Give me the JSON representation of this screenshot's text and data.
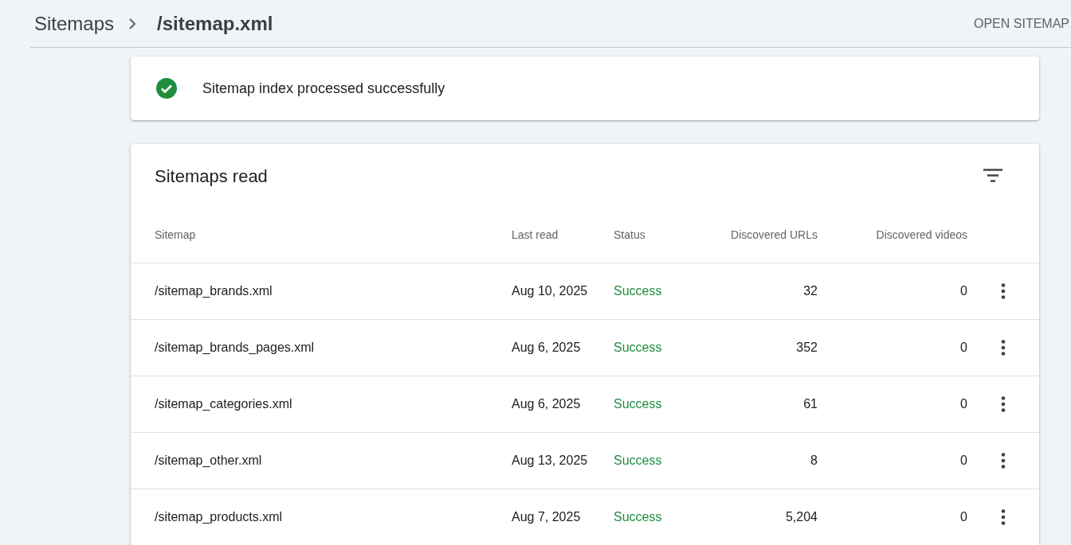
{
  "breadcrumb": [
    {
      "label": "Sitemaps"
    },
    {
      "label": "/sitemap.xml"
    }
  ],
  "header_action": "OPEN SITEMAP",
  "banner": {
    "message": "Sitemap index processed successfully"
  },
  "table": {
    "title": "Sitemaps read",
    "columns": [
      "Sitemap",
      "Last read",
      "Status",
      "Discovered URLs",
      "Discovered videos"
    ],
    "rows": [
      {
        "sitemap": "/sitemap_brands.xml",
        "last_read": "Aug 10, 2025",
        "status": "Success",
        "urls": "32",
        "videos": "0"
      },
      {
        "sitemap": "/sitemap_brands_pages.xml",
        "last_read": "Aug 6, 2025",
        "status": "Success",
        "urls": "352",
        "videos": "0"
      },
      {
        "sitemap": "/sitemap_categories.xml",
        "last_read": "Aug 6, 2025",
        "status": "Success",
        "urls": "61",
        "videos": "0"
      },
      {
        "sitemap": "/sitemap_other.xml",
        "last_read": "Aug 13, 2025",
        "status": "Success",
        "urls": "8",
        "videos": "0"
      },
      {
        "sitemap": "/sitemap_products.xml",
        "last_read": "Aug 7, 2025",
        "status": "Success",
        "urls": "5,204",
        "videos": "0"
      }
    ]
  }
}
